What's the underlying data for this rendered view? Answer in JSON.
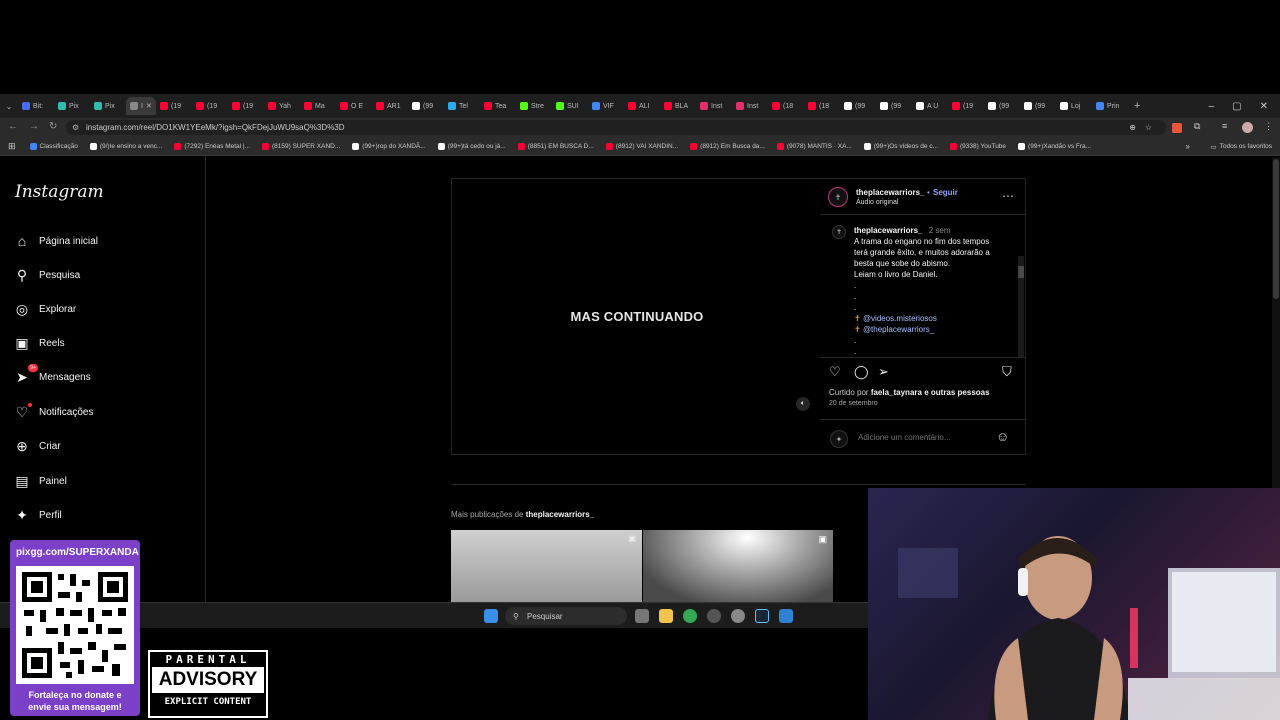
{
  "browser": {
    "tabs": [
      {
        "label": "Bit:",
        "color": "#4a6cf7"
      },
      {
        "label": "Pix",
        "color": "#32bcad"
      },
      {
        "label": "Pix",
        "color": "#32bcad"
      },
      {
        "label": "I",
        "color": "#888888",
        "active": true
      },
      {
        "label": "(19",
        "color": "#ff0033"
      },
      {
        "label": "(19",
        "color": "#ff0033"
      },
      {
        "label": "(19",
        "color": "#ff0033"
      },
      {
        "label": "Yah",
        "color": "#ff0033"
      },
      {
        "label": "Ma",
        "color": "#ff0033"
      },
      {
        "label": "O E",
        "color": "#ff0033"
      },
      {
        "label": "AR1",
        "color": "#ff0033"
      },
      {
        "label": "(99",
        "color": "#ffffff"
      },
      {
        "label": "Tel",
        "color": "#2aabee"
      },
      {
        "label": "Tea",
        "color": "#ff0033"
      },
      {
        "label": "Stre",
        "color": "#53fc18"
      },
      {
        "label": "SUI",
        "color": "#53fc18"
      },
      {
        "label": "VIF",
        "color": "#4285f4"
      },
      {
        "label": "ALI",
        "color": "#ff0033"
      },
      {
        "label": "BLA",
        "color": "#ff0033"
      },
      {
        "label": "Inst",
        "color": "#e1306c"
      },
      {
        "label": "Inst",
        "color": "#e1306c"
      },
      {
        "label": "(18",
        "color": "#ff0033"
      },
      {
        "label": "(18",
        "color": "#ff0033"
      },
      {
        "label": "(99",
        "color": "#ffffff"
      },
      {
        "label": "(99",
        "color": "#ffffff"
      },
      {
        "label": "A U",
        "color": "#ffffff"
      },
      {
        "label": "(19",
        "color": "#ff0033"
      },
      {
        "label": "(99",
        "color": "#ffffff"
      },
      {
        "label": "(99",
        "color": "#ffffff"
      },
      {
        "label": "Loj",
        "color": "#ffffff"
      },
      {
        "label": "Prin",
        "color": "#4285f4"
      }
    ],
    "url": "instagram.com/reel/DO1KW1YEeMk/?igsh=QkFDejJuWU9saQ%3D%3D",
    "bookmarks": [
      {
        "label": "Classificação",
        "color": "#4285f4"
      },
      {
        "label": "(9/)Ie ensino a venc...",
        "color": "#ffffff"
      },
      {
        "label": "(7292) Enéas Metal |...",
        "color": "#ff0033"
      },
      {
        "label": "(8159) SUPER XAND...",
        "color": "#ff0033"
      },
      {
        "label": "(99+)rop do XANDÃ...",
        "color": "#ffffff"
      },
      {
        "label": "(99+)tá cedo ou já...",
        "color": "#ffffff"
      },
      {
        "label": "(8851) EM BUSCA D...",
        "color": "#ff0033"
      },
      {
        "label": "(8912) VAI XANDIN...",
        "color": "#ff0033"
      },
      {
        "label": "(8912) Em Busca da...",
        "color": "#ff0033"
      },
      {
        "label": "(9078) MANTIS · XA...",
        "color": "#ff0033"
      },
      {
        "label": "(99+)Os vídeos de c...",
        "color": "#ffffff"
      },
      {
        "label": "(9338) YouTube",
        "color": "#ff0033"
      },
      {
        "label": "(99+)Xandão vs Fra...",
        "color": "#ffffff"
      }
    ],
    "all_bookmarks": "Todos os favoritos"
  },
  "instagram": {
    "logo": "Instagram",
    "nav": [
      {
        "label": "Página inicial",
        "icon": "home-icon",
        "glyph": "⌂"
      },
      {
        "label": "Pesquisa",
        "icon": "search-icon",
        "glyph": "⚲"
      },
      {
        "label": "Explorar",
        "icon": "compass-icon",
        "glyph": "◎"
      },
      {
        "label": "Reels",
        "icon": "reels-icon",
        "glyph": "▣"
      },
      {
        "label": "Mensagens",
        "icon": "messenger-icon",
        "glyph": "➤",
        "badge": "9+"
      },
      {
        "label": "Notificações",
        "icon": "heart-icon",
        "glyph": "♡",
        "dot": true
      },
      {
        "label": "Criar",
        "icon": "plus-icon",
        "glyph": "⊕"
      },
      {
        "label": "Painel",
        "icon": "dashboard-icon",
        "glyph": "▤"
      },
      {
        "label": "Perfil",
        "icon": "profile-avatar-icon",
        "glyph": "✦"
      }
    ],
    "reel_overlay_text": "MAS CONTINUANDO",
    "post": {
      "username": "theplacewarriors_",
      "follow_sep": "•",
      "follow": "Seguir",
      "audio": "Áudio original",
      "caption_user": "theplacewarriors_",
      "caption_time": "2 sem",
      "caption_lines": [
        "A trama do engano no fim dos tempos",
        "terá grande êxito, e muitos adorarão a",
        "besta que sobe do abismo.",
        "Leiam o livro de Daniel.",
        ".",
        ".",
        "."
      ],
      "mentions": [
        "@videos.misteriosos",
        "@theplacewarriors_"
      ],
      "caption_tail": [
        ".",
        "."
      ],
      "liked_prefix": "Curtido por",
      "liked_user": "faela_taynara",
      "liked_suffix": "e outras pessoas",
      "date": "20 de setembro",
      "comment_placeholder": "Adicione um comentário..."
    },
    "more_prefix": "Mais publicações de",
    "more_user": "theplacewarriors_"
  },
  "taskbar": {
    "search_placeholder": "Pesquisar"
  },
  "overlay": {
    "pix_url": "pixgg.com/SUPERXANDA",
    "pix_message_1": "Fortaleça no donate e",
    "pix_message_2": "envie sua mensagem!",
    "advisory_1": "PARENTAL",
    "advisory_2": "ADVISORY",
    "advisory_3": "EXPLICIT CONTENT"
  },
  "colors": {
    "instagram_bg": "#000000",
    "follow_blue": "#8fa7ff",
    "mention_blue": "#a8c0ff",
    "pix_purple": "#7b3fc8"
  }
}
